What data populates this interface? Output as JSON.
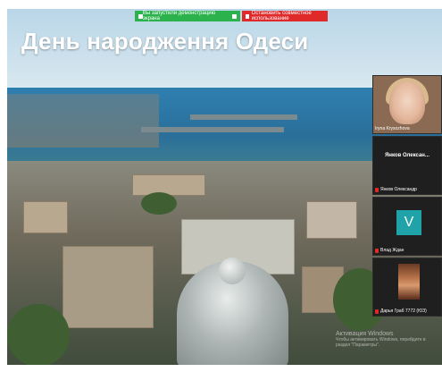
{
  "share_bar": {
    "status_text": "Вы запустили демонстрацию экрана",
    "stop_button_label": "Остановить совместное использование",
    "status_color": "#2bb24c",
    "stop_color": "#e02a2a"
  },
  "slide": {
    "title": "День народження Одеси"
  },
  "participants": [
    {
      "name": "Iryna Krysozhova",
      "type": "camera"
    },
    {
      "name": "Янков Олександр",
      "display_name": "Янков Олексан...",
      "type": "name-only",
      "muted": true
    },
    {
      "name": "Влад Ждан",
      "avatar_letter": "V",
      "type": "avatar",
      "muted": true
    },
    {
      "name": "Дарья Граб 7772 (ЮЗ)",
      "type": "portrait",
      "muted": true
    }
  ],
  "watermark": {
    "title": "Активация Windows",
    "subtitle": "Чтобы активировать Windows, перейдите в раздел \"Параметры\"."
  }
}
